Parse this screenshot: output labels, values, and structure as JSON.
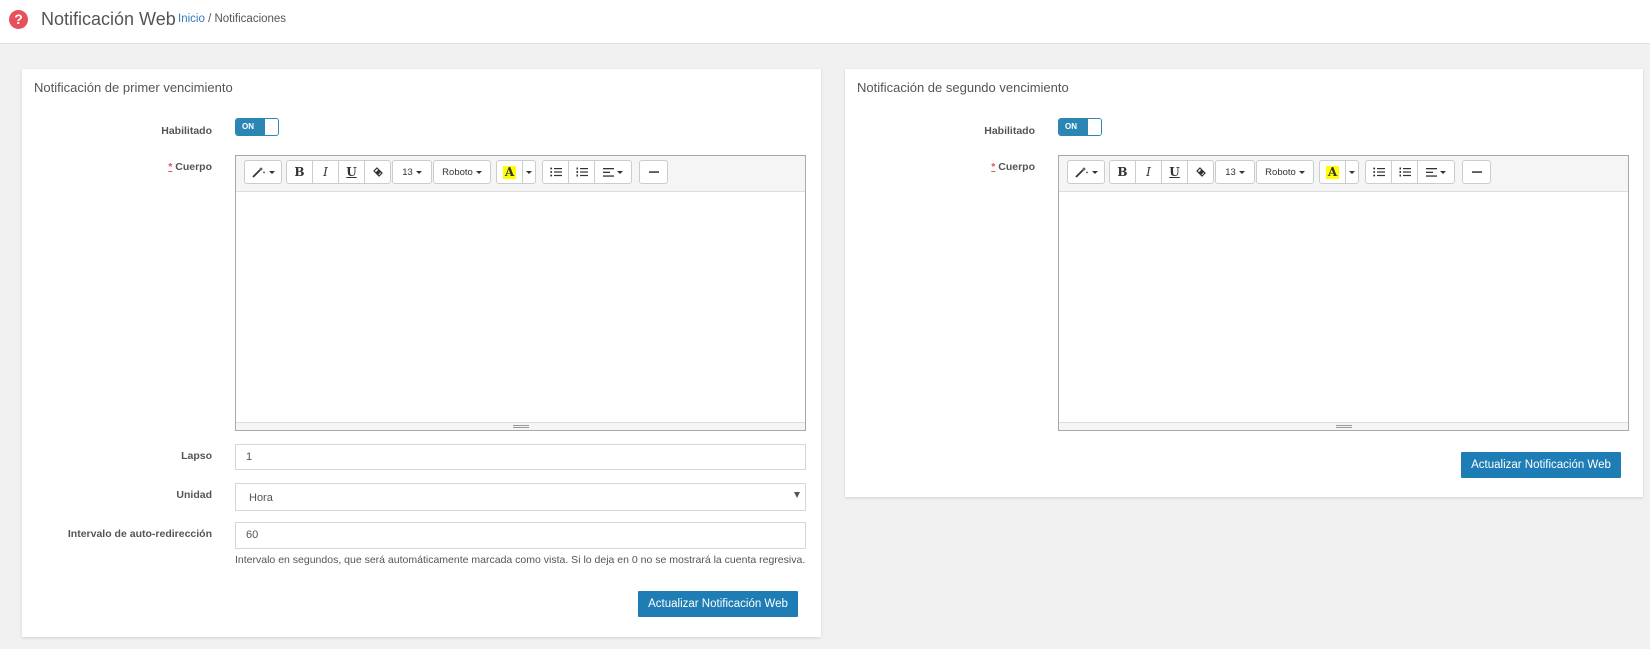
{
  "header": {
    "title": "Notificación Web",
    "breadcrumb_home": "Inicio",
    "breadcrumb_separator": "/",
    "breadcrumb_current": "Notificaciones"
  },
  "icons": {
    "help": "question-circle-icon",
    "magic": "magic-wand-icon",
    "eraser": "eraser-icon",
    "ul": "unordered-list-icon",
    "ol": "ordered-list-icon",
    "align": "align-left-icon",
    "hr": "horizontal-rule-icon"
  },
  "colors": {
    "accent": "#1d7db4",
    "danger": "#e7505a"
  },
  "editor_toolbar": {
    "bold": "B",
    "italic": "I",
    "underline": "U",
    "font_size": "13",
    "font_name": "Roboto",
    "color": "A"
  },
  "panel1": {
    "title": "Notificación de primer vencimiento",
    "enabled_label": "Habilitado",
    "toggle_text": "ON",
    "required_mark": "*",
    "body_label": "Cuerpo",
    "lapse_label": "Lapso",
    "lapse_value": "1",
    "unit_label": "Unidad",
    "unit_value": "Hora",
    "interval_label": "Intervalo de auto-redirección",
    "interval_value": "60",
    "interval_help": "Intervalo en segundos, que será automáticamente marcada como vista. Si lo deja en 0 no se mostrará la cuenta regresiva.",
    "submit": "Actualizar Notificación Web"
  },
  "panel2": {
    "title": "Notificación de segundo vencimiento",
    "enabled_label": "Habilitado",
    "toggle_text": "ON",
    "required_mark": "*",
    "body_label": "Cuerpo",
    "submit": "Actualizar Notificación Web"
  }
}
